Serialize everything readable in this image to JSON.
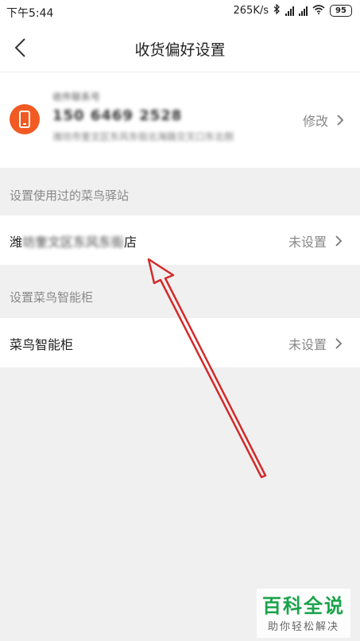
{
  "status_bar": {
    "time": "下午5:44",
    "speed": "265K/s",
    "battery": "95"
  },
  "header": {
    "title": "收货偏好设置"
  },
  "address": {
    "name_line": "收件联系号",
    "phone": "150 6469 2528",
    "address_line": "潍坊市奎文区东风东街北海路交叉口东北侧",
    "edit_label": "修改",
    "accent_color": "#f15a22"
  },
  "sections": {
    "station_header": "设置使用过的菜鸟驿站",
    "station_row": {
      "label_prefix": "潍",
      "label_blurred": "坊奎文区东风东街",
      "label_suffix": "店",
      "status": "未设置"
    },
    "locker_header": "设置菜鸟智能柜",
    "locker_row": {
      "label": "菜鸟智能柜",
      "status": "未设置"
    }
  },
  "watermark": {
    "main": "百科全说",
    "sub": "助你轻松解决"
  },
  "icons": {
    "back": "back-chevron-icon",
    "phone": "phone-icon",
    "chevron": "chevron-right-icon",
    "bluetooth": "bluetooth-icon",
    "wifi": "wifi-icon",
    "signal": "signal-icon"
  }
}
